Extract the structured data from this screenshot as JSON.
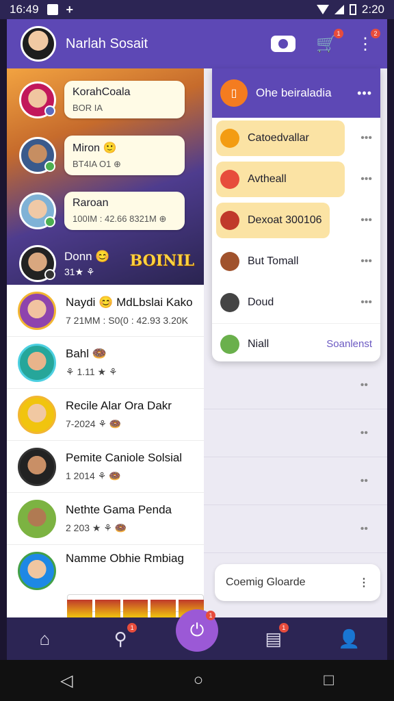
{
  "status": {
    "time": "16:49",
    "clock": "2:20",
    "plus": "+"
  },
  "header": {
    "title": "Narlah Sosait",
    "cart_badge": "1",
    "more_badge": "2"
  },
  "banner": {
    "rows": [
      {
        "name": "KorahCoala",
        "sub": "BOR IA"
      },
      {
        "name": "Miron 🙂",
        "sub": "BT4IA      O1 ⊕"
      },
      {
        "name": "Raroan",
        "sub": "100IM : 42.66 8321M ⊕"
      },
      {
        "name": "Donn 😊",
        "sub": "31★ ⚘"
      }
    ],
    "logo": "BOINIL"
  },
  "list": [
    {
      "name": "Naydi 😊 MdLbslai Kako",
      "sub": "7 21MM : S0(0 : 42.93 3.20K"
    },
    {
      "name": "Bahl 🍩",
      "sub": "⚘ 1.11 ★ ⚘"
    },
    {
      "name": "Recile Alar Ora Dakr",
      "sub": "7-2024 ⚘ 🍩"
    },
    {
      "name": "Pemite Caniole Solsial",
      "sub": "1 2014 ⚘ 🍩"
    },
    {
      "name": "Nethte Gama Penda",
      "sub": "2 203 ★ ⚘ 🍩"
    },
    {
      "name": "Namme Obhie Rmbiag",
      "sub": ""
    }
  ],
  "collapse_label": "v",
  "dropdown": {
    "title": "Ohe beiraladia",
    "more": "•••",
    "items": [
      {
        "label": "Catoedvallar",
        "more": "•••"
      },
      {
        "label": "Avtheall",
        "more": "•••"
      },
      {
        "label": "Dexoat 300106",
        "more": "•••"
      },
      {
        "label": "But Tomall",
        "more": "•••"
      },
      {
        "label": "Doud",
        "more": "•••"
      },
      {
        "label": "Niall",
        "action": "Soanlenst"
      }
    ]
  },
  "right_more": "••",
  "coming": {
    "label": "Coemig Gloarde",
    "more": "⋮"
  },
  "nav": {
    "center_badge": "1",
    "search_badge": "1",
    "doc_badge": "1"
  },
  "icons": [
    "home-icon",
    "search-icon",
    "center-action-icon",
    "document-icon",
    "profile-icon",
    "camera-icon",
    "cart-icon",
    "more-vertical-icon"
  ]
}
